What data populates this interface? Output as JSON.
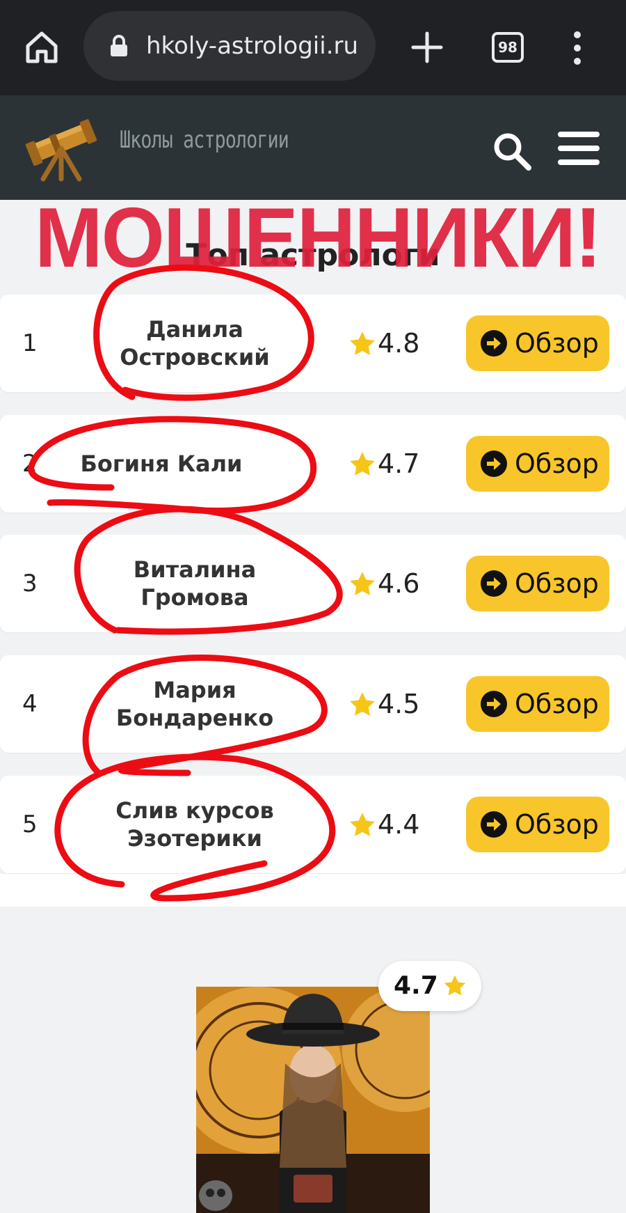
{
  "browser": {
    "url": "hkoly-astrologii.ru",
    "tab_count": "98"
  },
  "site": {
    "logo_text": "Школы астрологии"
  },
  "banner_text": "МОШЕННИКИ!",
  "section_title": "Топ астрологи",
  "rows": [
    {
      "rank": "1",
      "name": "Данила Островский",
      "rating": "4.8",
      "button": "Обзор"
    },
    {
      "rank": "2",
      "name": "Богиня Кали",
      "rating": "4.7",
      "button": "Обзор"
    },
    {
      "rank": "3",
      "name": "Виталина Громова",
      "rating": "4.6",
      "button": "Обзор"
    },
    {
      "rank": "4",
      "name": "Мария Бондаренко",
      "rating": "4.5",
      "button": "Обзор"
    },
    {
      "rank": "5",
      "name": "Слив курсов Эзотерики",
      "rating": "4.4",
      "button": "Обзор"
    }
  ],
  "card": {
    "rating": "4.7"
  },
  "colors": {
    "accent_button": "#f8c62a",
    "banner_red": "#e0203c",
    "star": "#f5c518",
    "header_bg": "#2c3337",
    "browser_bg": "#202124"
  },
  "icons": {
    "home": "home-icon",
    "lock": "lock-icon",
    "plus": "plus-icon",
    "tabs": "tabs-counter-icon",
    "more": "more-vert-icon",
    "search": "search-icon",
    "menu": "hamburger-menu-icon",
    "star": "star-icon",
    "arrow": "arrow-right-circle-icon"
  }
}
